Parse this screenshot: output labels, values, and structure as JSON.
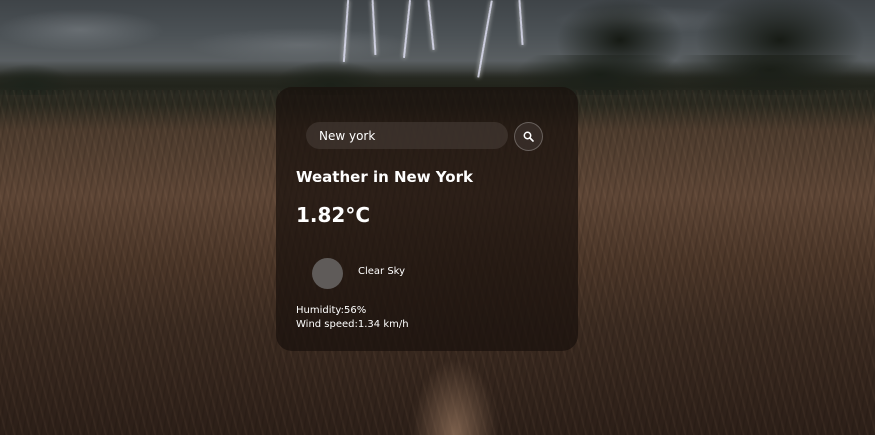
{
  "search": {
    "value": "New york",
    "button_icon": "search-icon"
  },
  "weather": {
    "title": "Weather in New York",
    "temperature": "1.82°C",
    "icon": "weather-condition-icon",
    "description": "Clear Sky",
    "humidity": "Humidity:56%",
    "wind": "Wind speed:1.34 km/h"
  },
  "colors": {
    "card_background": "#19100c",
    "text": "#ffffff",
    "icon_placeholder": "#5f5b59"
  }
}
